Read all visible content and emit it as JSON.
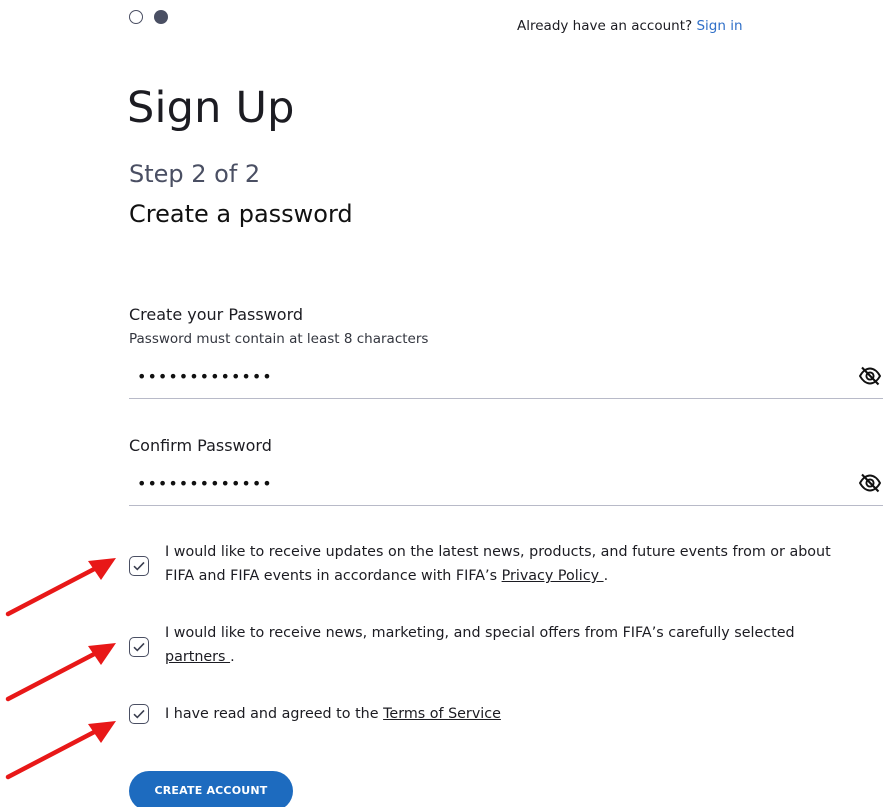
{
  "header": {
    "steps_total": 2,
    "current_step": 2,
    "signin_prompt": "Already have an account?",
    "signin_link": "Sign in"
  },
  "main": {
    "title": "Sign Up",
    "step_label": "Step 2 of 2",
    "subtitle": "Create a password"
  },
  "password": {
    "label": "Create your Password",
    "hint": "Password must contain at least 8 characters",
    "value": "•••••••••••••"
  },
  "confirm": {
    "label": "Confirm Password",
    "value": "•••••••••••••"
  },
  "consents": [
    {
      "text_before": "I would like to receive updates on the latest news, products, and future events from or about FIFA and FIFA events in accordance with FIFA’s ",
      "link": "Privacy Policy ",
      "text_after": ".",
      "checked": true
    },
    {
      "text_before": "I would like to receive news, marketing, and special offers from FIFA’s carefully selected ",
      "link": "partners ",
      "text_after": ".",
      "checked": true
    },
    {
      "text_before": "I have read and agreed to the ",
      "link": "Terms of Service",
      "text_after": "",
      "checked": true
    }
  ],
  "actions": {
    "create_account": "CREATE ACCOUNT"
  },
  "colors": {
    "primary_button": "#1d6bbf",
    "link": "#2f6fc8",
    "annotation_arrow": "#e81818"
  },
  "icons": {
    "password_toggle": "eye-off-icon",
    "checkbox": "checkmark-icon",
    "annotation": "red-arrow-icon"
  }
}
